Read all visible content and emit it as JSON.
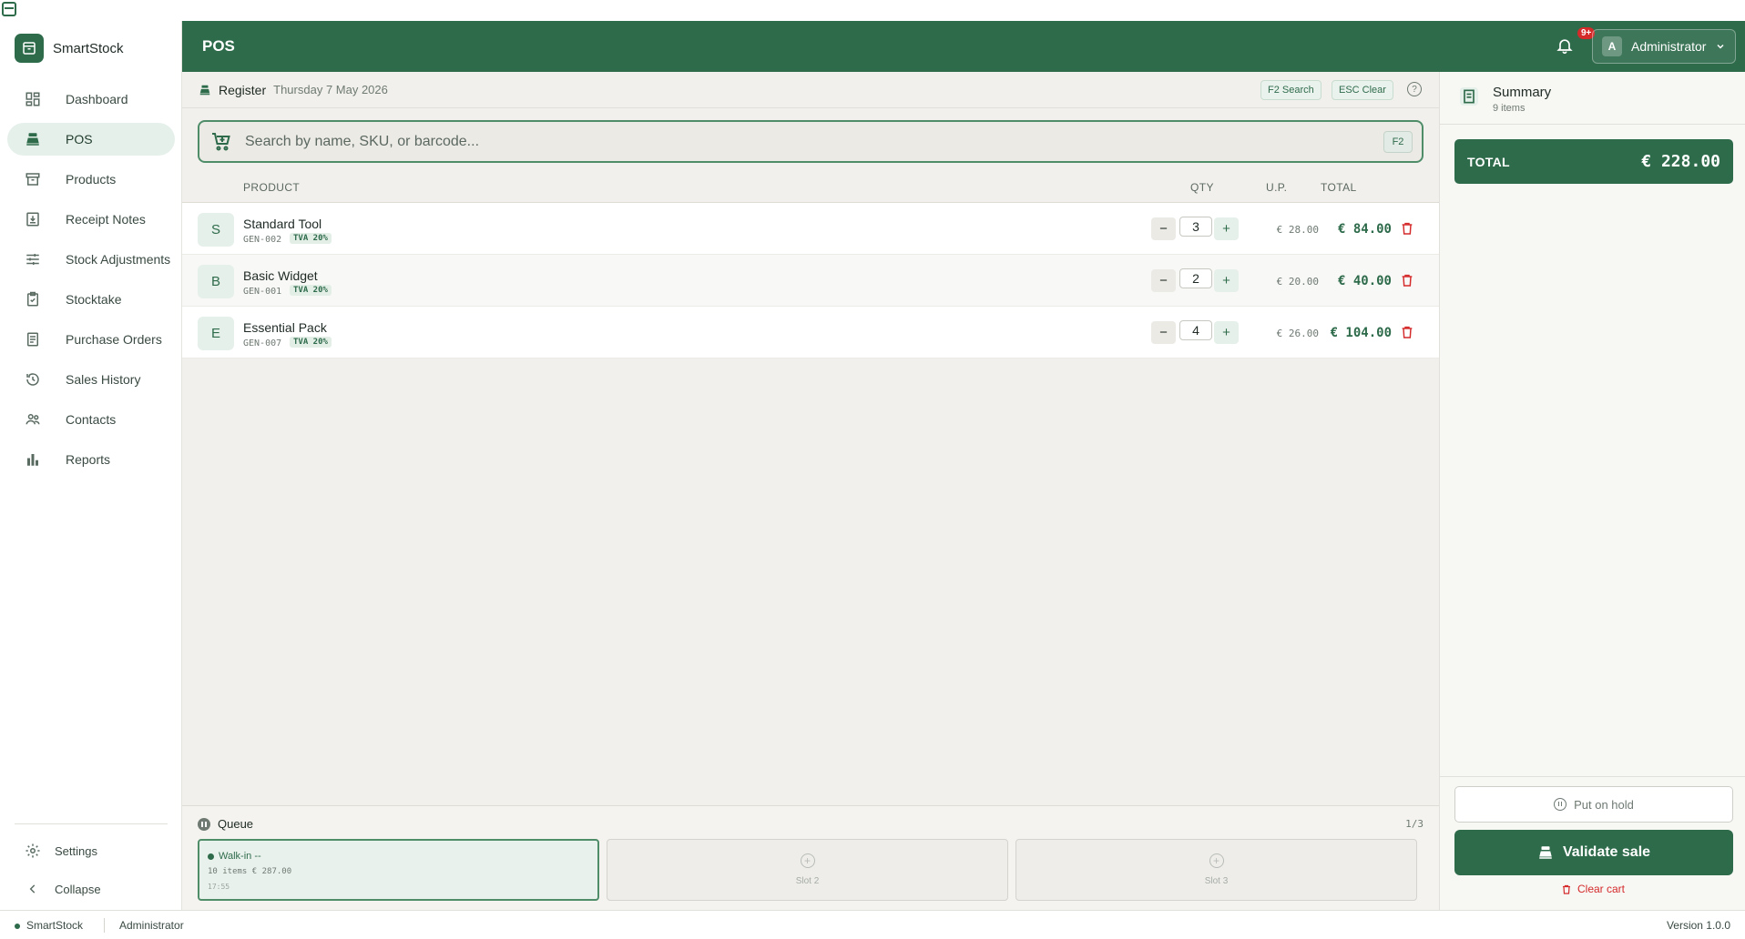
{
  "app": {
    "name": "SmartStock",
    "version": "Version 1.0.0"
  },
  "sidebar": {
    "items": [
      {
        "label": "Dashboard",
        "icon": "dashboard-icon"
      },
      {
        "label": "POS",
        "icon": "register-icon",
        "active": true
      },
      {
        "label": "Products",
        "icon": "box-icon"
      },
      {
        "label": "Receipt Notes",
        "icon": "receipt-download-icon"
      },
      {
        "label": "Stock Adjustments",
        "icon": "sliders-icon"
      },
      {
        "label": "Stocktake",
        "icon": "clipboard-check-icon"
      },
      {
        "label": "Purchase Orders",
        "icon": "purchase-order-icon"
      },
      {
        "label": "Sales History",
        "icon": "history-icon"
      },
      {
        "label": "Contacts",
        "icon": "people-icon"
      },
      {
        "label": "Reports",
        "icon": "bar-chart-icon"
      }
    ],
    "settings_label": "Settings",
    "collapse_label": "Collapse"
  },
  "header": {
    "title": "POS",
    "notification_count": "9+",
    "user_initial": "A",
    "user_name": "Administrator"
  },
  "register": {
    "title": "Register",
    "date": "Thursday 7 May 2026",
    "shortcut_search": "F2 Search",
    "shortcut_clear": "ESC Clear"
  },
  "search": {
    "placeholder": "Search by name, SKU, or barcode...",
    "shortcut": "F2"
  },
  "table": {
    "col_product": "PRODUCT",
    "col_qty": "QTY",
    "col_unit_price": "U.P.",
    "col_total": "TOTAL"
  },
  "cart": [
    {
      "letter": "S",
      "name": "Standard Tool",
      "sku": "GEN-002",
      "tax": "TVA 20%",
      "qty": "3",
      "unit_price": "€ 28.00",
      "line_total": "€ 84.00"
    },
    {
      "letter": "B",
      "name": "Basic Widget",
      "sku": "GEN-001",
      "tax": "TVA 20%",
      "qty": "2",
      "unit_price": "€ 20.00",
      "line_total": "€ 40.00"
    },
    {
      "letter": "E",
      "name": "Essential Pack",
      "sku": "GEN-007",
      "tax": "TVA 20%",
      "qty": "4",
      "unit_price": "€ 26.00",
      "line_total": "€ 104.00"
    }
  ],
  "queue": {
    "title": "Queue",
    "count": "1/3",
    "slots": [
      {
        "name": "Walk-in --",
        "info": "10 items  € 287.00",
        "time": "17:55"
      },
      {
        "label": "Slot 2"
      },
      {
        "label": "Slot 3"
      }
    ]
  },
  "summary": {
    "title": "Summary",
    "subtitle": "9 items",
    "total_label": "TOTAL",
    "total_value": "€ 228.00",
    "hold_label": "Put on hold",
    "validate_label": "Validate sale",
    "clear_label": "Clear cart"
  },
  "status": {
    "app": "SmartStock",
    "user": "Administrator"
  },
  "colors": {
    "brand": "#2e6b4b",
    "danger": "#d42a2a",
    "background": "#f1f0ec"
  }
}
